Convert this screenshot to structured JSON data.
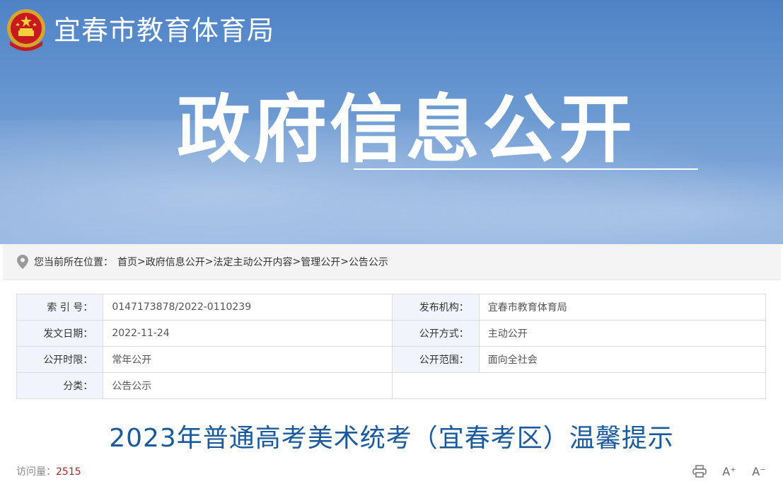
{
  "header": {
    "site_title": "宜春市教育体育局",
    "hero_title": "政府信息公开",
    "emblem_icon": "national-emblem-icon"
  },
  "breadcrumb": {
    "prefix": "您当前所在位置：",
    "items": [
      "首页",
      "政府信息公开",
      "法定主动公开内容",
      "管理公开",
      "公告公示"
    ],
    "separator": ">"
  },
  "meta": {
    "index_label": "索 引 号：",
    "index_value": "0147173878/2022-0110239",
    "publisher_label": "发布机构：",
    "publisher_value": "宜春市教育体育局",
    "date_label": "发文日期：",
    "date_value": "2022-11-24",
    "method_label": "公开方式：",
    "method_value": "主动公开",
    "period_label": "公开时限：",
    "period_value": "常年公开",
    "scope_label": "公开范围：",
    "scope_value": "面向全社会",
    "category_label": "分类：",
    "category_value": "公告公示"
  },
  "article": {
    "title": "2023年普通高考美术统考（宜春考区）温馨提示"
  },
  "stats": {
    "visits_label": "访问量：",
    "visits_value": "2515"
  },
  "tools": {
    "increase_font": "A⁺",
    "decrease_font": "A⁻"
  },
  "colors": {
    "banner_top": "#4f83c6",
    "title_blue": "#1a5a9c",
    "label_bg": "#f1f5fb"
  }
}
